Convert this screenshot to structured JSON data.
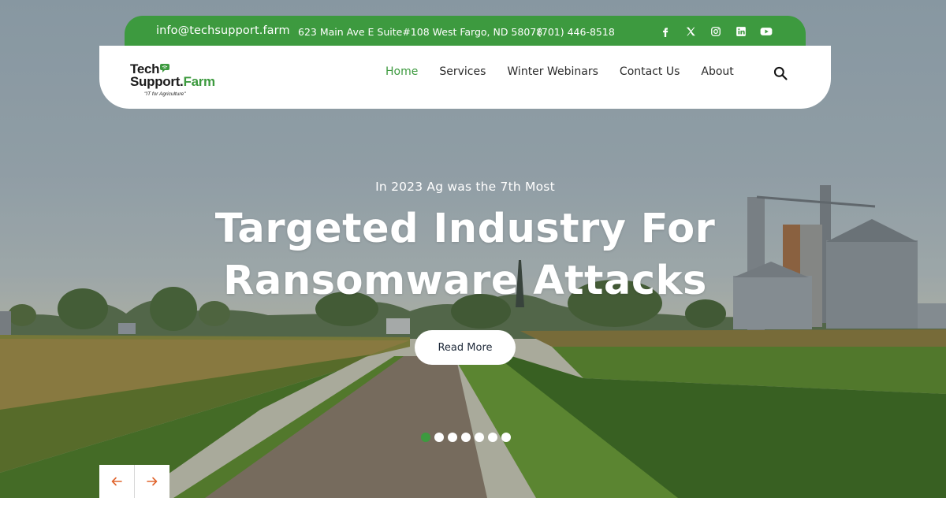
{
  "topbar": {
    "email": "info@techsupport.farm",
    "address": "623 Main Ave E Suite#108 West Fargo, ND 58078",
    "phone": "(701) 446-8518",
    "social": [
      "facebook-icon",
      "x-icon",
      "instagram-icon",
      "linkedin-icon",
      "youtube-icon"
    ],
    "background_color": "#3d9a3f"
  },
  "logo": {
    "line1": "Tech",
    "line2_main": "Support.",
    "line2_accent": "Farm",
    "tagline": "\"IT for Agriculture\""
  },
  "nav": {
    "items": [
      {
        "label": "Home",
        "active": true
      },
      {
        "label": "Services",
        "active": false
      },
      {
        "label": "Winter Webinars",
        "active": false
      },
      {
        "label": "Contact Us",
        "active": false
      },
      {
        "label": "About",
        "active": false
      }
    ],
    "search_icon": "search-icon",
    "active_color": "#3d9a3f"
  },
  "hero": {
    "subtitle": "In 2023 Ag was the 7th Most",
    "title_line1": "Targeted Industry For",
    "title_line2": "Ransomware Attacks",
    "cta_label": "Read More"
  },
  "slider": {
    "total_slides": 7,
    "active_index": 0,
    "prev_icon": "arrow-left-icon",
    "next_icon": "arrow-right-icon",
    "arrow_color": "#e0662f"
  }
}
